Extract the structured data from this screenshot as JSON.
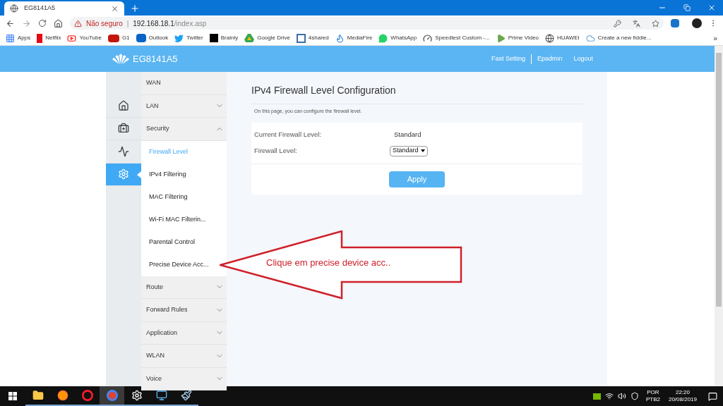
{
  "browser": {
    "tab": {
      "title": "EG8141A5",
      "selected": true
    },
    "address": {
      "security": "Não seguro",
      "separator": "|",
      "host": "192.168.18.1",
      "path": "/index.asp"
    },
    "bookmarks": [
      {
        "label": "Apps"
      },
      {
        "label": "Netflix"
      },
      {
        "label": "YouTube"
      },
      {
        "label": "G1"
      },
      {
        "label": "Outlook"
      },
      {
        "label": "Twitter"
      },
      {
        "label": "Brainly"
      },
      {
        "label": "Google Drive"
      },
      {
        "label": "4shared"
      },
      {
        "label": "MediaFire"
      },
      {
        "label": "WhatsApp"
      },
      {
        "label": "Speedtest Custom -..."
      },
      {
        "label": "Prime Video"
      },
      {
        "label": "HUAWEI"
      },
      {
        "label": "Create a new fiddle..."
      }
    ],
    "bookmarks_more": "»"
  },
  "header": {
    "logo": "EG8141A5",
    "links": [
      "Fast Setting",
      "Epadmin",
      "Logout"
    ]
  },
  "icon_nav": [
    {
      "selected": false
    },
    {
      "selected": false
    },
    {
      "selected": false
    },
    {
      "selected": true
    }
  ],
  "menu": [
    {
      "label": "WAN",
      "kind": "group"
    },
    {
      "label": "LAN",
      "kind": "group",
      "expanded": false
    },
    {
      "label": "Security",
      "kind": "group",
      "expanded": true,
      "children": [
        {
          "label": "Firewall Level",
          "selected": true
        },
        {
          "label": "IPv4 Filtering",
          "selected": false
        },
        {
          "label": "MAC Filtering",
          "selected": false
        },
        {
          "label": "Wi-Fi MAC Filterin...",
          "selected": false
        },
        {
          "label": "Parental Control",
          "selected": false
        },
        {
          "label": "Precise Device Acc...",
          "selected": false
        }
      ]
    },
    {
      "label": "Route",
      "kind": "group",
      "expanded": false
    },
    {
      "label": "Forward Rules",
      "kind": "group",
      "expanded": false
    },
    {
      "label": "Application",
      "kind": "group",
      "expanded": false
    },
    {
      "label": "WLAN",
      "kind": "group",
      "expanded": false
    },
    {
      "label": "Voice",
      "kind": "group",
      "expanded": false
    }
  ],
  "content": {
    "title": "IPv4 Firewall Level Configuration",
    "description": "On this page, you can configure the firewall level.",
    "fields": [
      {
        "label": "Current Firewall Level:",
        "kind": "text",
        "value": "Standard"
      },
      {
        "label": "Firewall Level:",
        "kind": "select",
        "value": "Standard"
      }
    ],
    "button": "Apply"
  },
  "annotation": {
    "text": "Clique em precise device acc.."
  },
  "taskbar": {
    "apps": [
      {
        "selected": false
      },
      {
        "selected": false
      },
      {
        "selected": false
      },
      {
        "selected": true
      },
      {
        "selected": false
      },
      {
        "selected": false
      },
      {
        "selected": false
      }
    ],
    "language": [
      "POR",
      "PTB2"
    ],
    "time": "22:20",
    "date": "20/08/2019"
  }
}
